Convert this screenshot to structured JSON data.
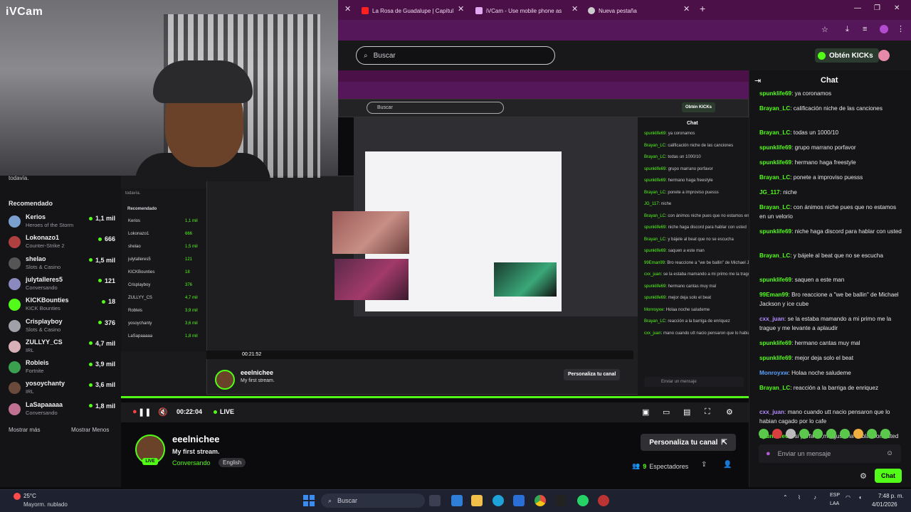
{
  "overlay": {
    "app_name": "iVCam",
    "partial_text": "todavía."
  },
  "browser": {
    "tabs": [
      {
        "label": "La Rosa de Guadalupe | Capítul",
        "color": "#ff2020"
      },
      {
        "label": "iVCam - Use mobile phone as",
        "color": "#e2a9f0"
      },
      {
        "label": "Nueva pestaña",
        "color": "#cccccc"
      }
    ],
    "new_tab": "+"
  },
  "header": {
    "search_placeholder": "Buscar",
    "kicks_label": "Obtén KICKs"
  },
  "sidebar": {
    "title": "Recomendado",
    "channels": [
      {
        "name": "Kerios",
        "category": "Heroes of the Storm",
        "viewers": "1,1 mil",
        "color": "#7aa0d0"
      },
      {
        "name": "Lokonazo1",
        "category": "Counter-Strike 2",
        "viewers": "666",
        "color": "#b04040"
      },
      {
        "name": "shelao",
        "category": "Slots & Casino",
        "viewers": "1,5 mil",
        "color": "#555555"
      },
      {
        "name": "julytalleres5",
        "category": "Conversando",
        "viewers": "121",
        "color": "#8a8ac0"
      },
      {
        "name": "KICKBounties",
        "category": "KICK Bounties",
        "viewers": "18",
        "color": "#53fc18"
      },
      {
        "name": "Crisplayboy",
        "category": "Slots & Casino",
        "viewers": "376",
        "color": "#a0a0a8"
      },
      {
        "name": "ZULLYY_CS",
        "category": "IRL",
        "viewers": "4,7 mil",
        "color": "#d9b0b8"
      },
      {
        "name": "Robleis",
        "category": "Fortnite",
        "viewers": "3,9 mil",
        "color": "#3aa050"
      },
      {
        "name": "yosoychanty",
        "category": "IRL",
        "viewers": "3,6 mil",
        "color": "#6a4a3a"
      },
      {
        "name": "LaSapaaaaa",
        "category": "Conversando",
        "viewers": "1,8 mil",
        "color": "#c07090"
      }
    ],
    "show_more": "Mostrar más",
    "show_less": "Mostrar Menos"
  },
  "player": {
    "time": "00:22:04",
    "live": "LIVE",
    "progress": 1.0,
    "nested_time": "00:21:52"
  },
  "stream": {
    "channel": "eeelnichee",
    "title": "My first stream.",
    "category": "Conversando",
    "language": "English",
    "customize": "Personaliza tu canal",
    "viewers_count": "9",
    "viewers_label": "Espectadores",
    "live_badge": "LIVE"
  },
  "chat": {
    "title": "Chat",
    "messages": [
      {
        "user": "spunklife69",
        "text": "ya coronamos",
        "color": "#53fc18"
      },
      {
        "user": "Brayan_LC",
        "text": "calificación niche de las canciones",
        "color": "#53fc18"
      },
      {
        "user": "Brayan_LC",
        "text": "todas un 1000/10",
        "color": "#53fc18"
      },
      {
        "user": "spunklife69",
        "text": "grupo marrano porfavor",
        "color": "#53fc18"
      },
      {
        "user": "spunklife69",
        "text": "hermano haga freestyle",
        "color": "#53fc18"
      },
      {
        "user": "Brayan_LC",
        "text": "ponete a improviso puesss",
        "color": "#53fc18"
      },
      {
        "user": "JG_117",
        "text": "niche",
        "color": "#53fc18"
      },
      {
        "user": "Brayan_LC",
        "text": "con ánimos niche pues que no estamos en un velorio",
        "color": "#53fc18"
      },
      {
        "user": "spunklife69",
        "text": "niche haga discord para hablar con usted",
        "color": "#53fc18"
      },
      {
        "user": "Brayan_LC",
        "text": "y bájele al beat que no se escucha",
        "color": "#53fc18"
      },
      {
        "user": "spunklife69",
        "text": "saquen a este man",
        "color": "#53fc18"
      },
      {
        "user": "99Eman99",
        "text": "Bro reaccione a \"we be ballin\" de Michael Jackson y ice cube",
        "color": "#53fc18"
      },
      {
        "user": "cxx_juan",
        "text": "se la estaba mamando a mi primo me la trague y me levante a aplaudir",
        "color": "#b48cff"
      },
      {
        "user": "spunklife69",
        "text": "hermano cantas muy mal",
        "color": "#53fc18"
      },
      {
        "user": "spunklife69",
        "text": "mejor deja solo el beat",
        "color": "#53fc18"
      },
      {
        "user": "Monroyxw",
        "text": "Holaa noche saludeme",
        "color": "#5aa0ff"
      },
      {
        "user": "Brayan_LC",
        "text": "reacción a la barriga de enriquez",
        "color": "#53fc18"
      },
      {
        "user": "cxx_juan",
        "text": "mano cuando utt nacio pensaron que lo habian cagado por lo cafe",
        "color": "#b48cff"
      },
      {
        "user": "spunklife69",
        "text": "si porfavor,me gustaria hablar con usted",
        "color": "#53fc18"
      }
    ],
    "input_placeholder": "Enviar un mensaje",
    "send_label": "Chat"
  },
  "taskbar": {
    "temperature": "25°C",
    "weather": "Mayorm. nublado",
    "search": "Buscar",
    "lang_top": "ESP",
    "lang_bottom": "LAA",
    "time": "7:48 p. m.",
    "date": "4/01/2026"
  },
  "colors": {
    "kick_green": "#53fc18",
    "browser_purple": "#4a1047"
  }
}
